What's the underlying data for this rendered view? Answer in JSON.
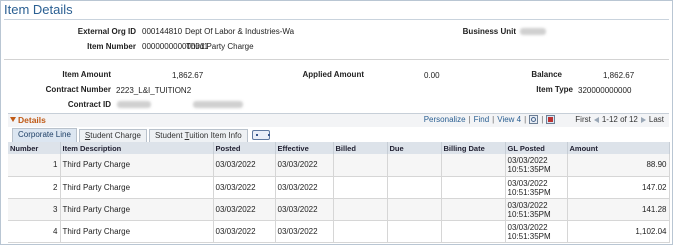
{
  "page": {
    "title": "Item Details"
  },
  "header": {
    "external_org_label": "External Org ID",
    "external_org_id": "000144810",
    "external_org_name": "Dept Of Labor & Industries-Wa",
    "item_number_label": "Item Number",
    "item_number": "000000000000011",
    "item_number_desc": "Third Party Charge",
    "business_unit_label": "Business Unit"
  },
  "summary": {
    "item_amount_label": "Item Amount",
    "item_amount": "1,862.67",
    "applied_amount_label": "Applied Amount",
    "applied_amount": "0.00",
    "balance_label": "Balance",
    "balance": "1,862.67",
    "contract_number_label": "Contract Number",
    "contract_number": "2223_L&I_TUITION2",
    "item_type_label": "Item Type",
    "item_type": "320000000000",
    "contract_id_label": "Contract ID"
  },
  "details": {
    "title": "Details",
    "personalize": "Personalize",
    "find": "Find",
    "view": "View 4",
    "first": "First",
    "range": "1-12 of 12",
    "last": "Last",
    "tabs": [
      {
        "pre": "Corporate Line",
        "u": "",
        "post": ""
      },
      {
        "pre": "",
        "u": "S",
        "post": "tudent Charge"
      },
      {
        "pre": "Student ",
        "u": "T",
        "post": "uition Item Info"
      }
    ],
    "columns": [
      "Number",
      "Item Description",
      "Posted",
      "Effective",
      "Billed",
      "Due",
      "Billing Date",
      "GL Posted",
      "Amount"
    ],
    "rows": [
      {
        "number": "1",
        "desc": "Third Party Charge",
        "posted": "03/03/2022",
        "effective": "03/03/2022",
        "billed": "",
        "due": "",
        "billing_date": "",
        "gl_date": "03/03/2022",
        "gl_time": "10:51:35PM",
        "amount": "88.90"
      },
      {
        "number": "2",
        "desc": "Third Party Charge",
        "posted": "03/03/2022",
        "effective": "03/03/2022",
        "billed": "",
        "due": "",
        "billing_date": "",
        "gl_date": "03/03/2022",
        "gl_time": "10:51:35PM",
        "amount": "147.02"
      },
      {
        "number": "3",
        "desc": "Third Party Charge",
        "posted": "03/03/2022",
        "effective": "03/03/2022",
        "billed": "",
        "due": "",
        "billing_date": "",
        "gl_date": "03/03/2022",
        "gl_time": "10:51:35PM",
        "amount": "141.28"
      },
      {
        "number": "4",
        "desc": "Third Party Charge",
        "posted": "03/03/2022",
        "effective": "03/03/2022",
        "billed": "",
        "due": "",
        "billing_date": "",
        "gl_date": "03/03/2022",
        "gl_time": "10:51:35PM",
        "amount": "1,102.04"
      }
    ]
  },
  "colors": {
    "title": "#2a5f92",
    "details_title": "#c05a16",
    "link": "#2a5f92",
    "header_bg": "#dde3ea"
  }
}
